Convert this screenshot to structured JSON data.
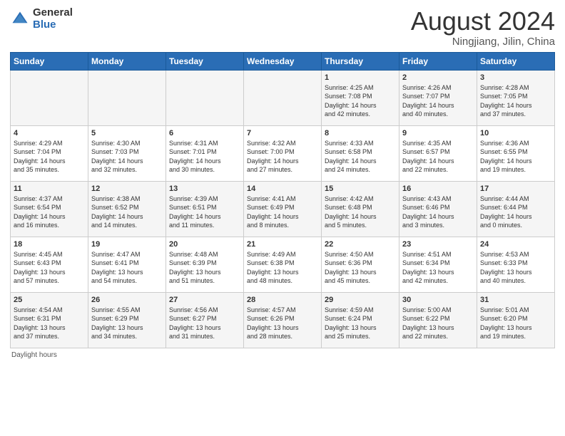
{
  "header": {
    "logo_general": "General",
    "logo_blue": "Blue",
    "title": "August 2024",
    "location": "Ningjiang, Jilin, China"
  },
  "days_of_week": [
    "Sunday",
    "Monday",
    "Tuesday",
    "Wednesday",
    "Thursday",
    "Friday",
    "Saturday"
  ],
  "weeks": [
    [
      {
        "day": "",
        "info": ""
      },
      {
        "day": "",
        "info": ""
      },
      {
        "day": "",
        "info": ""
      },
      {
        "day": "",
        "info": ""
      },
      {
        "day": "1",
        "info": "Sunrise: 4:25 AM\nSunset: 7:08 PM\nDaylight: 14 hours\nand 42 minutes."
      },
      {
        "day": "2",
        "info": "Sunrise: 4:26 AM\nSunset: 7:07 PM\nDaylight: 14 hours\nand 40 minutes."
      },
      {
        "day": "3",
        "info": "Sunrise: 4:28 AM\nSunset: 7:05 PM\nDaylight: 14 hours\nand 37 minutes."
      }
    ],
    [
      {
        "day": "4",
        "info": "Sunrise: 4:29 AM\nSunset: 7:04 PM\nDaylight: 14 hours\nand 35 minutes."
      },
      {
        "day": "5",
        "info": "Sunrise: 4:30 AM\nSunset: 7:03 PM\nDaylight: 14 hours\nand 32 minutes."
      },
      {
        "day": "6",
        "info": "Sunrise: 4:31 AM\nSunset: 7:01 PM\nDaylight: 14 hours\nand 30 minutes."
      },
      {
        "day": "7",
        "info": "Sunrise: 4:32 AM\nSunset: 7:00 PM\nDaylight: 14 hours\nand 27 minutes."
      },
      {
        "day": "8",
        "info": "Sunrise: 4:33 AM\nSunset: 6:58 PM\nDaylight: 14 hours\nand 24 minutes."
      },
      {
        "day": "9",
        "info": "Sunrise: 4:35 AM\nSunset: 6:57 PM\nDaylight: 14 hours\nand 22 minutes."
      },
      {
        "day": "10",
        "info": "Sunrise: 4:36 AM\nSunset: 6:55 PM\nDaylight: 14 hours\nand 19 minutes."
      }
    ],
    [
      {
        "day": "11",
        "info": "Sunrise: 4:37 AM\nSunset: 6:54 PM\nDaylight: 14 hours\nand 16 minutes."
      },
      {
        "day": "12",
        "info": "Sunrise: 4:38 AM\nSunset: 6:52 PM\nDaylight: 14 hours\nand 14 minutes."
      },
      {
        "day": "13",
        "info": "Sunrise: 4:39 AM\nSunset: 6:51 PM\nDaylight: 14 hours\nand 11 minutes."
      },
      {
        "day": "14",
        "info": "Sunrise: 4:41 AM\nSunset: 6:49 PM\nDaylight: 14 hours\nand 8 minutes."
      },
      {
        "day": "15",
        "info": "Sunrise: 4:42 AM\nSunset: 6:48 PM\nDaylight: 14 hours\nand 5 minutes."
      },
      {
        "day": "16",
        "info": "Sunrise: 4:43 AM\nSunset: 6:46 PM\nDaylight: 14 hours\nand 3 minutes."
      },
      {
        "day": "17",
        "info": "Sunrise: 4:44 AM\nSunset: 6:44 PM\nDaylight: 14 hours\nand 0 minutes."
      }
    ],
    [
      {
        "day": "18",
        "info": "Sunrise: 4:45 AM\nSunset: 6:43 PM\nDaylight: 13 hours\nand 57 minutes."
      },
      {
        "day": "19",
        "info": "Sunrise: 4:47 AM\nSunset: 6:41 PM\nDaylight: 13 hours\nand 54 minutes."
      },
      {
        "day": "20",
        "info": "Sunrise: 4:48 AM\nSunset: 6:39 PM\nDaylight: 13 hours\nand 51 minutes."
      },
      {
        "day": "21",
        "info": "Sunrise: 4:49 AM\nSunset: 6:38 PM\nDaylight: 13 hours\nand 48 minutes."
      },
      {
        "day": "22",
        "info": "Sunrise: 4:50 AM\nSunset: 6:36 PM\nDaylight: 13 hours\nand 45 minutes."
      },
      {
        "day": "23",
        "info": "Sunrise: 4:51 AM\nSunset: 6:34 PM\nDaylight: 13 hours\nand 42 minutes."
      },
      {
        "day": "24",
        "info": "Sunrise: 4:53 AM\nSunset: 6:33 PM\nDaylight: 13 hours\nand 40 minutes."
      }
    ],
    [
      {
        "day": "25",
        "info": "Sunrise: 4:54 AM\nSunset: 6:31 PM\nDaylight: 13 hours\nand 37 minutes."
      },
      {
        "day": "26",
        "info": "Sunrise: 4:55 AM\nSunset: 6:29 PM\nDaylight: 13 hours\nand 34 minutes."
      },
      {
        "day": "27",
        "info": "Sunrise: 4:56 AM\nSunset: 6:27 PM\nDaylight: 13 hours\nand 31 minutes."
      },
      {
        "day": "28",
        "info": "Sunrise: 4:57 AM\nSunset: 6:26 PM\nDaylight: 13 hours\nand 28 minutes."
      },
      {
        "day": "29",
        "info": "Sunrise: 4:59 AM\nSunset: 6:24 PM\nDaylight: 13 hours\nand 25 minutes."
      },
      {
        "day": "30",
        "info": "Sunrise: 5:00 AM\nSunset: 6:22 PM\nDaylight: 13 hours\nand 22 minutes."
      },
      {
        "day": "31",
        "info": "Sunrise: 5:01 AM\nSunset: 6:20 PM\nDaylight: 13 hours\nand 19 minutes."
      }
    ]
  ],
  "footer": {
    "text": "Daylight hours"
  }
}
